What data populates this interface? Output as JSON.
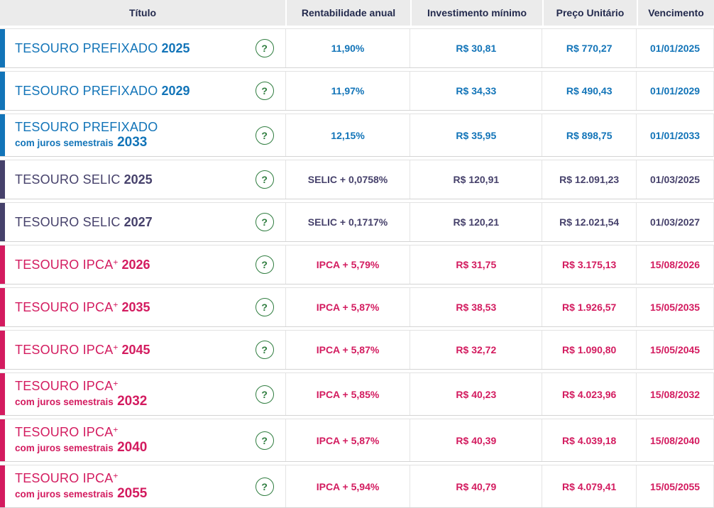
{
  "colors": {
    "prefixado": "#1274b8",
    "selic": "#46416b",
    "ipca": "#d31b5f",
    "help_green": "#2f7d3f",
    "header_bg": "#ebebeb",
    "header_text": "#232a4d"
  },
  "icons": {
    "help_glyph": "?"
  },
  "header": {
    "titulo": "Título",
    "rentabilidade": "Rentabilidade anual",
    "investimento": "Investimento mínimo",
    "preco": "Preço Unitário",
    "vencimento": "Vencimento"
  },
  "rows": [
    {
      "type": "prefixado",
      "name": "TESOURO PREFIXADO",
      "sup": "",
      "subtitle": "",
      "year": "2025",
      "rentabilidade": "11,90%",
      "investimento": "R$ 30,81",
      "preco": "R$ 770,27",
      "vencimento": "01/01/2025"
    },
    {
      "type": "prefixado",
      "name": "TESOURO PREFIXADO",
      "sup": "",
      "subtitle": "",
      "year": "2029",
      "rentabilidade": "11,97%",
      "investimento": "R$ 34,33",
      "preco": "R$ 490,43",
      "vencimento": "01/01/2029"
    },
    {
      "type": "prefixado",
      "name": "TESOURO PREFIXADO",
      "sup": "",
      "subtitle": "com juros semestrais",
      "year": "2033",
      "rentabilidade": "12,15%",
      "investimento": "R$ 35,95",
      "preco": "R$ 898,75",
      "vencimento": "01/01/2033"
    },
    {
      "type": "selic",
      "name": "TESOURO SELIC",
      "sup": "",
      "subtitle": "",
      "year": "2025",
      "rentabilidade": "SELIC + 0,0758%",
      "investimento": "R$ 120,91",
      "preco": "R$ 12.091,23",
      "vencimento": "01/03/2025"
    },
    {
      "type": "selic",
      "name": "TESOURO SELIC",
      "sup": "",
      "subtitle": "",
      "year": "2027",
      "rentabilidade": "SELIC + 0,1717%",
      "investimento": "R$ 120,21",
      "preco": "R$ 12.021,54",
      "vencimento": "01/03/2027"
    },
    {
      "type": "ipca",
      "name": "TESOURO IPCA",
      "sup": "+",
      "subtitle": "",
      "year": "2026",
      "rentabilidade": "IPCA + 5,79%",
      "investimento": "R$ 31,75",
      "preco": "R$ 3.175,13",
      "vencimento": "15/08/2026"
    },
    {
      "type": "ipca",
      "name": "TESOURO IPCA",
      "sup": "+",
      "subtitle": "",
      "year": "2035",
      "rentabilidade": "IPCA + 5,87%",
      "investimento": "R$ 38,53",
      "preco": "R$ 1.926,57",
      "vencimento": "15/05/2035"
    },
    {
      "type": "ipca",
      "name": "TESOURO IPCA",
      "sup": "+",
      "subtitle": "",
      "year": "2045",
      "rentabilidade": "IPCA + 5,87%",
      "investimento": "R$ 32,72",
      "preco": "R$ 1.090,80",
      "vencimento": "15/05/2045"
    },
    {
      "type": "ipca",
      "name": "TESOURO IPCA",
      "sup": "+",
      "subtitle": "com juros semestrais",
      "year": "2032",
      "rentabilidade": "IPCA + 5,85%",
      "investimento": "R$ 40,23",
      "preco": "R$ 4.023,96",
      "vencimento": "15/08/2032"
    },
    {
      "type": "ipca",
      "name": "TESOURO IPCA",
      "sup": "+",
      "subtitle": "com juros semestrais",
      "year": "2040",
      "rentabilidade": "IPCA + 5,87%",
      "investimento": "R$ 40,39",
      "preco": "R$ 4.039,18",
      "vencimento": "15/08/2040"
    },
    {
      "type": "ipca",
      "name": "TESOURO IPCA",
      "sup": "+",
      "subtitle": "com juros semestrais",
      "year": "2055",
      "rentabilidade": "IPCA + 5,94%",
      "investimento": "R$ 40,79",
      "preco": "R$ 4.079,41",
      "vencimento": "15/05/2055"
    }
  ]
}
